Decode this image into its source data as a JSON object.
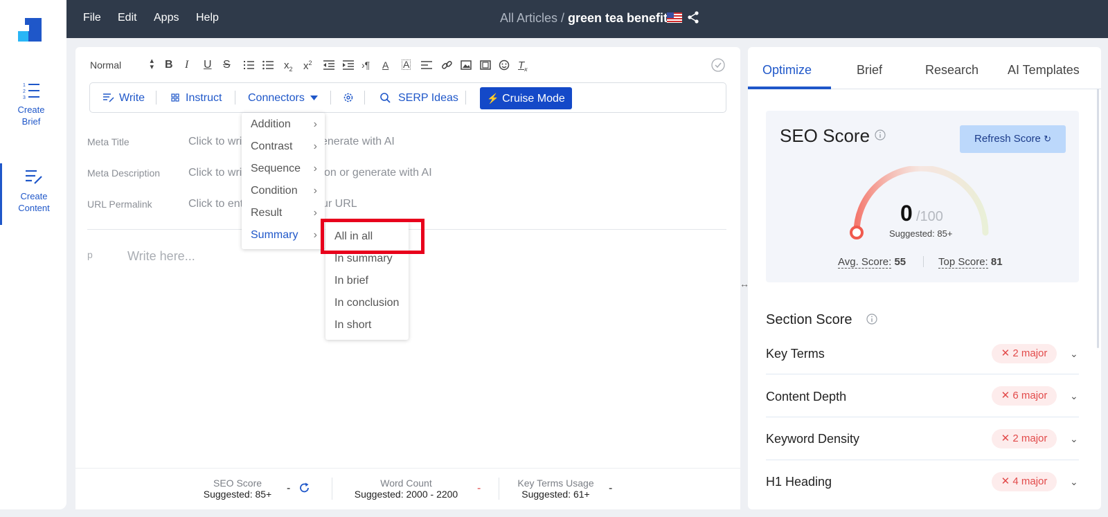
{
  "rail": {
    "items": [
      {
        "label_line1": "Create",
        "label_line2": "Brief",
        "icon": "list-icon"
      },
      {
        "label_line1": "Create",
        "label_line2": "Content",
        "icon": "edit-list-icon"
      }
    ]
  },
  "menu": [
    "File",
    "Edit",
    "Apps",
    "Help"
  ],
  "breadcrumb": {
    "parent": "All Articles",
    "separator": "/",
    "current": "green tea benefits"
  },
  "toolbar": {
    "style_select": "Normal"
  },
  "toolbar2": {
    "write": "Write",
    "instruct": "Instruct",
    "connectors": "Connectors",
    "serp": "SERP Ideas",
    "cruise": "Cruise Mode"
  },
  "meta": [
    {
      "label": "Meta Title",
      "value": "Click to write or generate with AI",
      "visible_left": "Click to wri",
      "visible_right": "enerate with AI"
    },
    {
      "label": "Meta Description",
      "value": "Click to write description or generate with AI",
      "visible_left": "Click to wri",
      "visible_right": "on or generate with AI"
    },
    {
      "label": "URL Permalink",
      "value": "Click to enter your URL",
      "visible_left": "Click to ent",
      "visible_right": "ur URL"
    }
  ],
  "editor": {
    "block_tag": "p",
    "placeholder": "Write here..."
  },
  "connectors_menu": [
    "Addition",
    "Contrast",
    "Sequence",
    "Condition",
    "Result",
    "Summary"
  ],
  "summary_submenu": [
    "All in all",
    "In summary",
    "In brief",
    "In conclusion",
    "In short"
  ],
  "status": [
    {
      "label": "SEO Score",
      "suggested": "Suggested: 85+",
      "value": "-"
    },
    {
      "label": "Word Count",
      "suggested": "Suggested: 2000 - 2200",
      "value": "-"
    },
    {
      "label": "Key Terms Usage",
      "suggested": "Suggested: 61+",
      "value": "-"
    }
  ],
  "tabs": [
    "Optimize",
    "Brief",
    "Research",
    "AI Templates"
  ],
  "seo": {
    "title": "SEO Score",
    "refresh": "Refresh Score",
    "score": "0",
    "max": "/100",
    "suggested": "Suggested: 85+",
    "avg_label": "Avg. Score:",
    "avg_value": "55",
    "top_label": "Top Score:",
    "top_value": "81"
  },
  "section": {
    "title": "Section Score",
    "rows": [
      {
        "label": "Key Terms",
        "badge": "2 major"
      },
      {
        "label": "Content Depth",
        "badge": "6 major"
      },
      {
        "label": "Keyword Density",
        "badge": "2 major"
      },
      {
        "label": "H1 Heading",
        "badge": "4 major"
      }
    ]
  },
  "colors": {
    "accent": "#1f57c9",
    "topbar": "#2f3a4a",
    "highlight": "#e8001c",
    "cruise": "#1449c8"
  }
}
